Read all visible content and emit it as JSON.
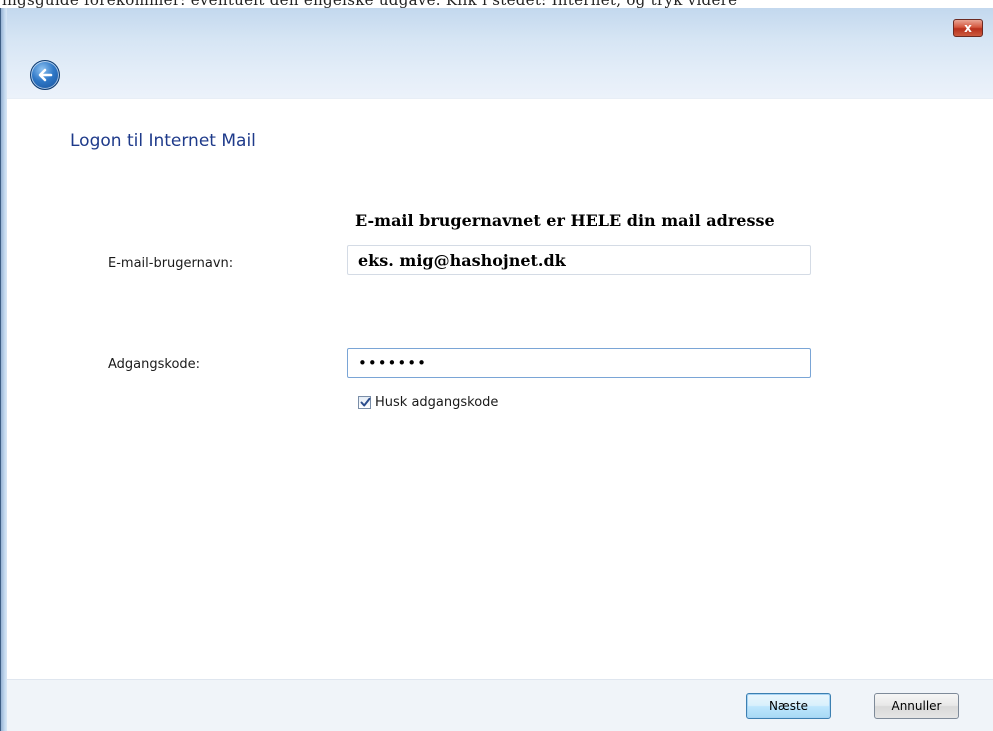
{
  "cropped_text": "ingsguide forekommer: eventuelt den engelske udgave. Klik i stedet: Internet, og tryk videre",
  "window": {
    "close_glyph": "x"
  },
  "page": {
    "title": "Logon til Internet Mail",
    "hint": "E-mail brugernavnet er HELE din mail adresse"
  },
  "email": {
    "label": "E-mail-brugernavn:",
    "value": "eks. mig@hashojnet.dk"
  },
  "password": {
    "label": "Adgangskode:",
    "value": "•••••••"
  },
  "remember": {
    "label": "Husk adgangskode",
    "checked": true
  },
  "buttons": {
    "next": "Næste",
    "cancel": "Annuller"
  }
}
